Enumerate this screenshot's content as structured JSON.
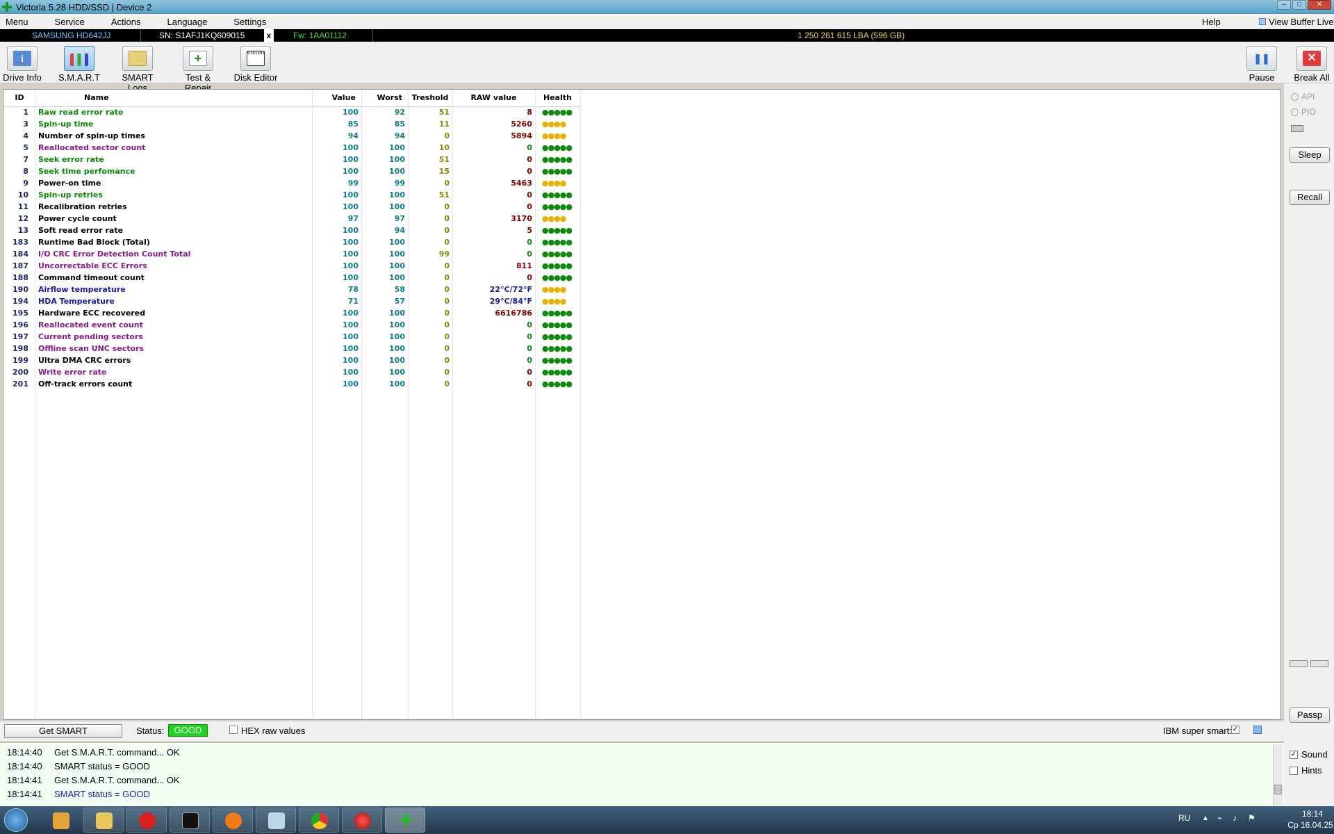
{
  "window": {
    "title": "Victoria 5.28 HDD/SSD | Device 2",
    "controls": [
      "–",
      "□",
      "✕"
    ]
  },
  "menu": {
    "items": [
      "Menu",
      "Service",
      "Actions",
      "Language",
      "Settings"
    ],
    "help": "Help",
    "view_buffer": "View Buffer Live"
  },
  "infobar": {
    "model": "SAMSUNG HD642JJ",
    "serial": "SN: S1AFJ1KQ609015",
    "close": "x",
    "firmware": "Fw: 1AA01112",
    "lba": "1 250 261 615 LBA (596 GB)"
  },
  "toolbar": {
    "drive_info": "Drive Info",
    "smart": "S.M.A.R.T",
    "smart_logs": "SMART Logs",
    "test_repair": "Test & Repair",
    "disk_editor": "Disk Editor",
    "pause": "Pause",
    "break_all": "Break All"
  },
  "colors": {
    "green": "#0b8a0b",
    "black": "#000000",
    "purple": "#8a1a8a",
    "blue": "#1a1aaa",
    "raw_red": "#8a0000",
    "raw_green": "#0b8a0b",
    "raw_blue": "#1a1aaa",
    "hl_green": "#0b8a0b",
    "hl_yellow": "#e8b000"
  },
  "table": {
    "headers": [
      "ID",
      "Name",
      "Value",
      "Worst",
      "Treshold",
      "RAW value",
      "Health"
    ],
    "rows": [
      {
        "id": "1",
        "name": "Raw read error rate",
        "value": "100",
        "worst": "92",
        "thr": "51",
        "raw": "8",
        "health": "●●●●●",
        "nc": "green",
        "rc": "raw_red",
        "hc": "hl_green"
      },
      {
        "id": "3",
        "name": "Spin-up time",
        "value": "85",
        "worst": "85",
        "thr": "11",
        "raw": "5260",
        "health": "●●●●",
        "nc": "green",
        "rc": "raw_red",
        "hc": "hl_yellow"
      },
      {
        "id": "4",
        "name": "Number of spin-up times",
        "value": "94",
        "worst": "94",
        "thr": "0",
        "raw": "5894",
        "health": "●●●●",
        "nc": "black",
        "rc": "raw_red",
        "hc": "hl_yellow"
      },
      {
        "id": "5",
        "name": "Reallocated sector count",
        "value": "100",
        "worst": "100",
        "thr": "10",
        "raw": "0",
        "health": "●●●●●",
        "nc": "purple",
        "rc": "raw_green",
        "hc": "hl_green"
      },
      {
        "id": "7",
        "name": "Seek error rate",
        "value": "100",
        "worst": "100",
        "thr": "51",
        "raw": "0",
        "health": "●●●●●",
        "nc": "green",
        "rc": "raw_red",
        "hc": "hl_green"
      },
      {
        "id": "8",
        "name": "Seek time perfomance",
        "value": "100",
        "worst": "100",
        "thr": "15",
        "raw": "0",
        "health": "●●●●●",
        "nc": "green",
        "rc": "raw_red",
        "hc": "hl_green"
      },
      {
        "id": "9",
        "name": "Power-on time",
        "value": "99",
        "worst": "99",
        "thr": "0",
        "raw": "5463",
        "health": "●●●●",
        "nc": "black",
        "rc": "raw_red",
        "hc": "hl_yellow"
      },
      {
        "id": "10",
        "name": "Spin-up retries",
        "value": "100",
        "worst": "100",
        "thr": "51",
        "raw": "0",
        "health": "●●●●●",
        "nc": "green",
        "rc": "raw_red",
        "hc": "hl_green"
      },
      {
        "id": "11",
        "name": "Recalibration retries",
        "value": "100",
        "worst": "100",
        "thr": "0",
        "raw": "0",
        "health": "●●●●●",
        "nc": "black",
        "rc": "raw_red",
        "hc": "hl_green"
      },
      {
        "id": "12",
        "name": "Power cycle count",
        "value": "97",
        "worst": "97",
        "thr": "0",
        "raw": "3170",
        "health": "●●●●",
        "nc": "black",
        "rc": "raw_red",
        "hc": "hl_yellow"
      },
      {
        "id": "13",
        "name": "Soft read error rate",
        "value": "100",
        "worst": "94",
        "thr": "0",
        "raw": "5",
        "health": "●●●●●",
        "nc": "black",
        "rc": "raw_red",
        "hc": "hl_green"
      },
      {
        "id": "183",
        "name": "Runtime Bad Block (Total)",
        "value": "100",
        "worst": "100",
        "thr": "0",
        "raw": "0",
        "health": "●●●●●",
        "nc": "black",
        "rc": "raw_green",
        "hc": "hl_green"
      },
      {
        "id": "184",
        "name": "I/O CRC Error Detection Count Total",
        "value": "100",
        "worst": "100",
        "thr": "99",
        "raw": "0",
        "health": "●●●●●",
        "nc": "purple",
        "rc": "raw_green",
        "hc": "hl_green"
      },
      {
        "id": "187",
        "name": "Uncorrectable ECC Errors",
        "value": "100",
        "worst": "100",
        "thr": "0",
        "raw": "811",
        "health": "●●●●●",
        "nc": "purple",
        "rc": "raw_red",
        "hc": "hl_green"
      },
      {
        "id": "188",
        "name": "Command timeout count",
        "value": "100",
        "worst": "100",
        "thr": "0",
        "raw": "0",
        "health": "●●●●●",
        "nc": "black",
        "rc": "raw_red",
        "hc": "hl_green"
      },
      {
        "id": "190",
        "name": "Airflow temperature",
        "value": "78",
        "worst": "58",
        "thr": "0",
        "raw": "22°C/72°F",
        "health": "●●●●",
        "nc": "blue",
        "rc": "raw_blue",
        "hc": "hl_yellow"
      },
      {
        "id": "194",
        "name": "HDA Temperature",
        "value": "71",
        "worst": "57",
        "thr": "0",
        "raw": "29°C/84°F",
        "health": "●●●●",
        "nc": "blue",
        "rc": "raw_blue",
        "hc": "hl_yellow"
      },
      {
        "id": "195",
        "name": "Hardware ECC recovered",
        "value": "100",
        "worst": "100",
        "thr": "0",
        "raw": "6616786",
        "health": "●●●●●",
        "nc": "black",
        "rc": "raw_red",
        "hc": "hl_green"
      },
      {
        "id": "196",
        "name": "Reallocated event count",
        "value": "100",
        "worst": "100",
        "thr": "0",
        "raw": "0",
        "health": "●●●●●",
        "nc": "purple",
        "rc": "raw_green",
        "hc": "hl_green"
      },
      {
        "id": "197",
        "name": "Current pending sectors",
        "value": "100",
        "worst": "100",
        "thr": "0",
        "raw": "0",
        "health": "●●●●●",
        "nc": "purple",
        "rc": "raw_green",
        "hc": "hl_green"
      },
      {
        "id": "198",
        "name": "Offline scan UNC sectors",
        "value": "100",
        "worst": "100",
        "thr": "0",
        "raw": "0",
        "health": "●●●●●",
        "nc": "purple",
        "rc": "raw_green",
        "hc": "hl_green"
      },
      {
        "id": "199",
        "name": "Ultra DMA CRC errors",
        "value": "100",
        "worst": "100",
        "thr": "0",
        "raw": "0",
        "health": "●●●●●",
        "nc": "black",
        "rc": "raw_green",
        "hc": "hl_green"
      },
      {
        "id": "200",
        "name": "Write error rate",
        "value": "100",
        "worst": "100",
        "thr": "0",
        "raw": "0",
        "health": "●●●●●",
        "nc": "purple",
        "rc": "raw_red",
        "hc": "hl_green"
      },
      {
        "id": "201",
        "name": "Off-track errors count",
        "value": "100",
        "worst": "100",
        "thr": "0",
        "raw": "0",
        "health": "●●●●●",
        "nc": "black",
        "rc": "raw_red",
        "hc": "hl_green"
      }
    ]
  },
  "right_panel": {
    "api": "API",
    "pio": "PIO",
    "sleep": "Sleep",
    "recall": "Recall",
    "passp": "Passp",
    "sound": "Sound",
    "hints": "Hints"
  },
  "status": {
    "get_smart": "Get SMART",
    "label": "Status:",
    "value": "GOOD",
    "hex_raw": "HEX raw values",
    "ibm_super_smart": "IBM super smart:"
  },
  "log": [
    {
      "time": "18:14:40",
      "msg": "Get S.M.A.R.T. command... OK",
      "color": "#000000"
    },
    {
      "time": "18:14:40",
      "msg": "SMART status = GOOD",
      "color": "#000000"
    },
    {
      "time": "18:14:41",
      "msg": "Get S.M.A.R.T. command... OK",
      "color": "#000000"
    },
    {
      "time": "18:14:41",
      "msg": "SMART status = GOOD",
      "color": "#1a1aaa"
    }
  ],
  "taskbar": {
    "lang": "RU",
    "time": "18:14",
    "date": "Ср 16.04.25"
  }
}
